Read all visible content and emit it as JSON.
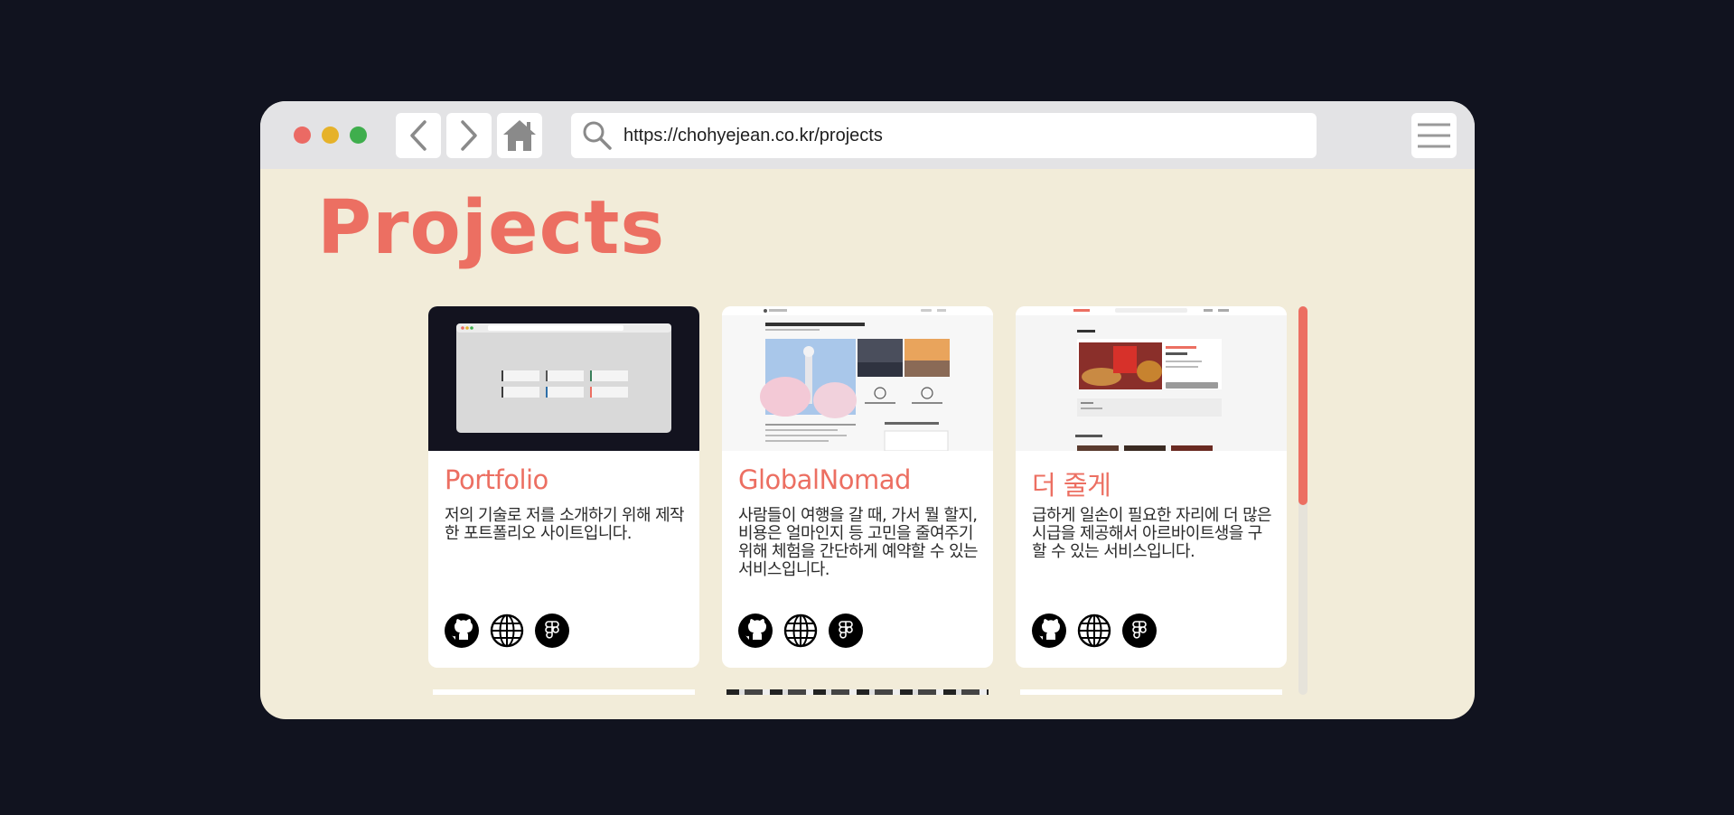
{
  "browser": {
    "url": "https://chohyejean.co.kr/projects",
    "icons": [
      "back-icon",
      "forward-icon",
      "home-icon",
      "search-icon",
      "menu-icon"
    ]
  },
  "page": {
    "title": "Projects",
    "accent_color": "#ec6f62",
    "background": "#f2ecd9"
  },
  "projects": [
    {
      "title": "Portfolio",
      "description": "저의 기술로 저를 소개하기 위해 제작한 포트폴리오 사이트입니다.",
      "links": [
        "github-icon",
        "globe-icon",
        "figma-icon"
      ]
    },
    {
      "title": "GlobalNomad",
      "description": "사람들이 여행을 갈 때, 가서 뭘 할지, 비용은 얼마인지 등 고민을 줄여주기 위해 체험을 간단하게 예약할 수 있는 서비스입니다.",
      "links": [
        "github-icon",
        "globe-icon",
        "figma-icon"
      ]
    },
    {
      "title": "더 줄게",
      "description": "급하게 일손이 필요한 자리에 더 많은 시급을 제공해서 아르바이트생을 구할 수 있는 서비스입니다.",
      "links": [
        "github-icon",
        "globe-icon",
        "figma-icon"
      ]
    }
  ]
}
